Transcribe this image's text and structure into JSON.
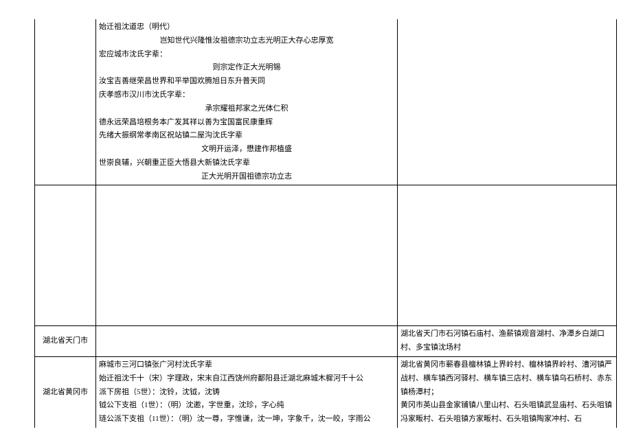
{
  "row1": {
    "col1": "",
    "mid": {
      "l1": "始迁祖沈道忠（明代）",
      "l2": "岂知世代兴隆惟汝祖德宗功立志光明正大存心忠厚宽",
      "l3": "宏应城市沈氏字辈：",
      "l4": "则宗定作正大光明锡",
      "l5": "汝宝吉善继荣昌世界和平举国欢腾旭日东升普天同",
      "l6": "庆孝感市汉川市沈氏字辈：",
      "l7": "承宗耀祖邦家之光体仁积",
      "l8": "德永远荣昌培根务本广发其祥以善为宝国富民康重辉",
      "l9": "先绪大振纲常孝南区祝站镇二屋沟沈氏字辈",
      "l10": "文明开运泽，懋建作邦植盛",
      "l11": "世崇良辅，兴朝重正臣大悟县大新镇沈氏字辈",
      "l12": "正大光明开国祖德宗功立志"
    },
    "col3": ""
  },
  "blank": {
    "col1": "",
    "col2": "",
    "col3": ""
  },
  "row2": {
    "col1": "湖北省天门市",
    "col2": "",
    "col3": "湖北省天门市石河镇石庙村、渔薪镇观音湖村、净潭乡白湖口村、多宝镇沈场村"
  },
  "row3": {
    "col1": "湖北省黄冈市",
    "mid": {
      "l1": "麻城市三河口镇张广河村沈氏字辈",
      "l2": "始迁祖沈千十（宋）字理政，宋末自江西饶州府鄱阳县迁湖北麻城木樨河千十公",
      "l3": "派下房祖（5世）：沈铃，沈钺，沈铸",
      "l4": "钺公下支祖（1世）：（明）沈遬，字世重，沈珍，字心纯",
      "l5": "琏公派下支祖（11世）：（明）沈一尊，字惟谦，沈一坤，字象千，沈一皎，字雨公"
    },
    "col3": "湖北省黄冈市蕲春县檀林镇上界岭村、檀林镇界岭村、漕河镇严战村、横车镇西河驿村、横车镇三店村、横车镇乌石桥村、赤东镇杨潭村；\n黄冈市英山县金家铺镇八里山村、石头咀镇武显庙村、石头咀镇冯家畈村、石头咀镇方家畈村、石头咀镇陶家冲村、石"
  }
}
